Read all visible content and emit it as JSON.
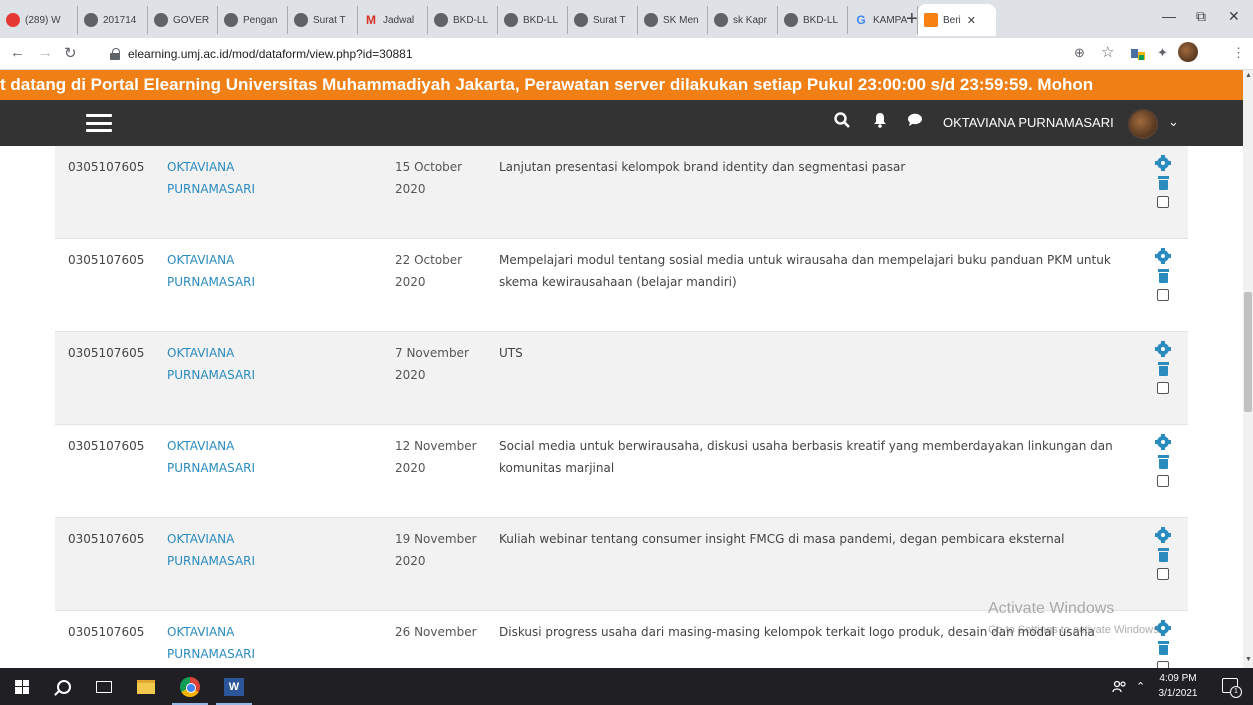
{
  "browser": {
    "tabs": [
      {
        "label": "(289) W",
        "icon": "youtube-icon",
        "w": 78
      },
      {
        "label": "201714",
        "icon": "globe-icon",
        "w": 70
      },
      {
        "label": "GOVER",
        "icon": "globe-icon",
        "w": 70
      },
      {
        "label": "Pengan",
        "icon": "globe-icon",
        "w": 70
      },
      {
        "label": "Surat T",
        "icon": "globe-icon",
        "w": 70
      },
      {
        "label": "Jadwal",
        "icon": "gmail-icon",
        "w": 70
      },
      {
        "label": "BKD-LL",
        "icon": "globe-icon",
        "w": 70
      },
      {
        "label": "BKD-LL",
        "icon": "globe-icon",
        "w": 70
      },
      {
        "label": "Surat T",
        "icon": "globe-icon",
        "w": 70
      },
      {
        "label": "SK Men",
        "icon": "globe-icon",
        "w": 70
      },
      {
        "label": "sk Kapr",
        "icon": "globe-icon",
        "w": 70
      },
      {
        "label": "BKD-LL",
        "icon": "globe-icon",
        "w": 70
      },
      {
        "label": "KAMPA",
        "icon": "google-icon",
        "w": 70
      },
      {
        "label": "Beri",
        "icon": "moodle-icon",
        "w": 78,
        "active": true
      }
    ],
    "new_tab": "+",
    "url": "elearning.umj.ac.id/mod/dataform/view.php?id=30881",
    "zoom_icon": "⊕",
    "star_icon": "☆"
  },
  "marquee_text": "t datang di Portal Elearning Universitas Muhammadiyah Jakarta, Perawatan server dilakukan setiap Pukul 23:00:00 s/d 23:59:59. Mohon",
  "navbar": {
    "user_name": "OKTAVIANA PURNAMASARI",
    "caret": "⌄"
  },
  "rows": [
    {
      "id": "0305107605",
      "name": "OKTAVIANA PURNAMASARI",
      "date": "15 October 2020",
      "desc": "Lanjutan presentasi kelompok brand identity dan segmentasi pasar"
    },
    {
      "id": "0305107605",
      "name": "OKTAVIANA PURNAMASARI",
      "date": "22 October 2020",
      "desc": "Mempelajari modul tentang sosial media untuk wirausaha dan mempelajari buku panduan PKM untuk skema kewirausahaan (belajar mandiri)"
    },
    {
      "id": "0305107605",
      "name": "OKTAVIANA PURNAMASARI",
      "date": "7 November 2020",
      "desc": "UTS"
    },
    {
      "id": "0305107605",
      "name": "OKTAVIANA PURNAMASARI",
      "date": "12 November 2020",
      "desc": "Social media untuk berwirausaha, diskusi usaha berbasis kreatif yang memberdayakan linkungan dan komunitas marjinal"
    },
    {
      "id": "0305107605",
      "name": "OKTAVIANA PURNAMASARI",
      "date": "19 November 2020",
      "desc": "Kuliah webinar tentang consumer insight FMCG di masa pandemi, degan pembicara eksternal"
    },
    {
      "id": "0305107605",
      "name": "OKTAVIANA PURNAMASARI",
      "date": "26 November",
      "desc": "Diskusi progress usaha dari masing-masing kelompok terkait logo produk, desain dan modal usaha"
    }
  ],
  "watermark": {
    "title": "Activate Windows",
    "subtitle": "Go to Settings to activate Windows."
  },
  "taskbar": {
    "time": "4:09 PM",
    "date": "3/1/2021",
    "word_letter": "W",
    "notif_count": "1"
  }
}
